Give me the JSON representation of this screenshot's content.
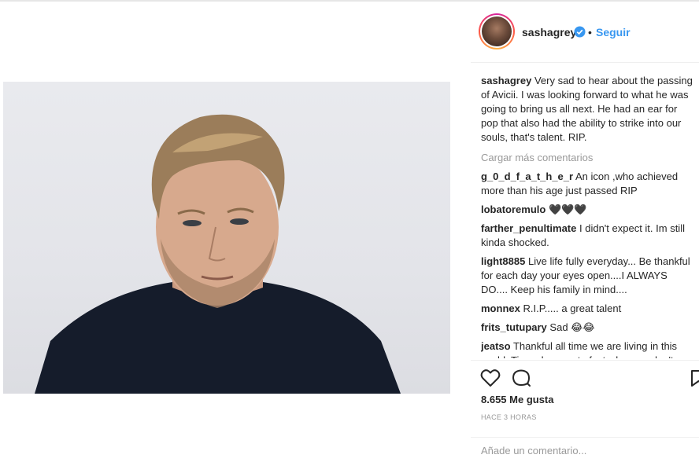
{
  "post": {
    "image_icon": "portrait-photo",
    "author": "sashagrey",
    "follow_label": "Seguir",
    "dot": "•",
    "caption": "Very sad to hear about the passing of Avicii. I was looking forward to what he was going to bring us all next. He had an ear for pop that also had the ability to strike into our souls, that's talent. RIP."
  },
  "load_more_label": "Cargar más comentarios",
  "comments": [
    {
      "user": "g_0_d_f_a_t_h_e_r",
      "text": "An icon ,who achieved more than his age just passed RIP"
    },
    {
      "user": "lobatoremulo",
      "text": "🖤🖤🖤"
    },
    {
      "user": "farther_penultimate",
      "text": "I didn't expect it. Im still kinda shocked."
    },
    {
      "user": "light8885",
      "text": "Live life fully everyday... Be thankful for each day your eyes open....I ALWAYS DO.... Keep his family in mind...."
    },
    {
      "user": "monnex",
      "text": "R.I.P..... a great talent"
    },
    {
      "user": "frits_tutupary",
      "text": "Sad 😂😂"
    },
    {
      "user": "jeatso",
      "text": "Thankful all time we are living in this world. Time changes to fast when we don't even..."
    }
  ],
  "likes": "8.655 Me gusta",
  "timestamp": "HACE 3 HORAS",
  "add_comment_placeholder": "Añade un comentario...",
  "icons": [
    "verified-badge-icon",
    "heart-icon",
    "comment-icon",
    "bookmark-icon"
  ],
  "colors": {
    "link": "#3897f0",
    "muted": "#999999",
    "text": "#262626"
  }
}
